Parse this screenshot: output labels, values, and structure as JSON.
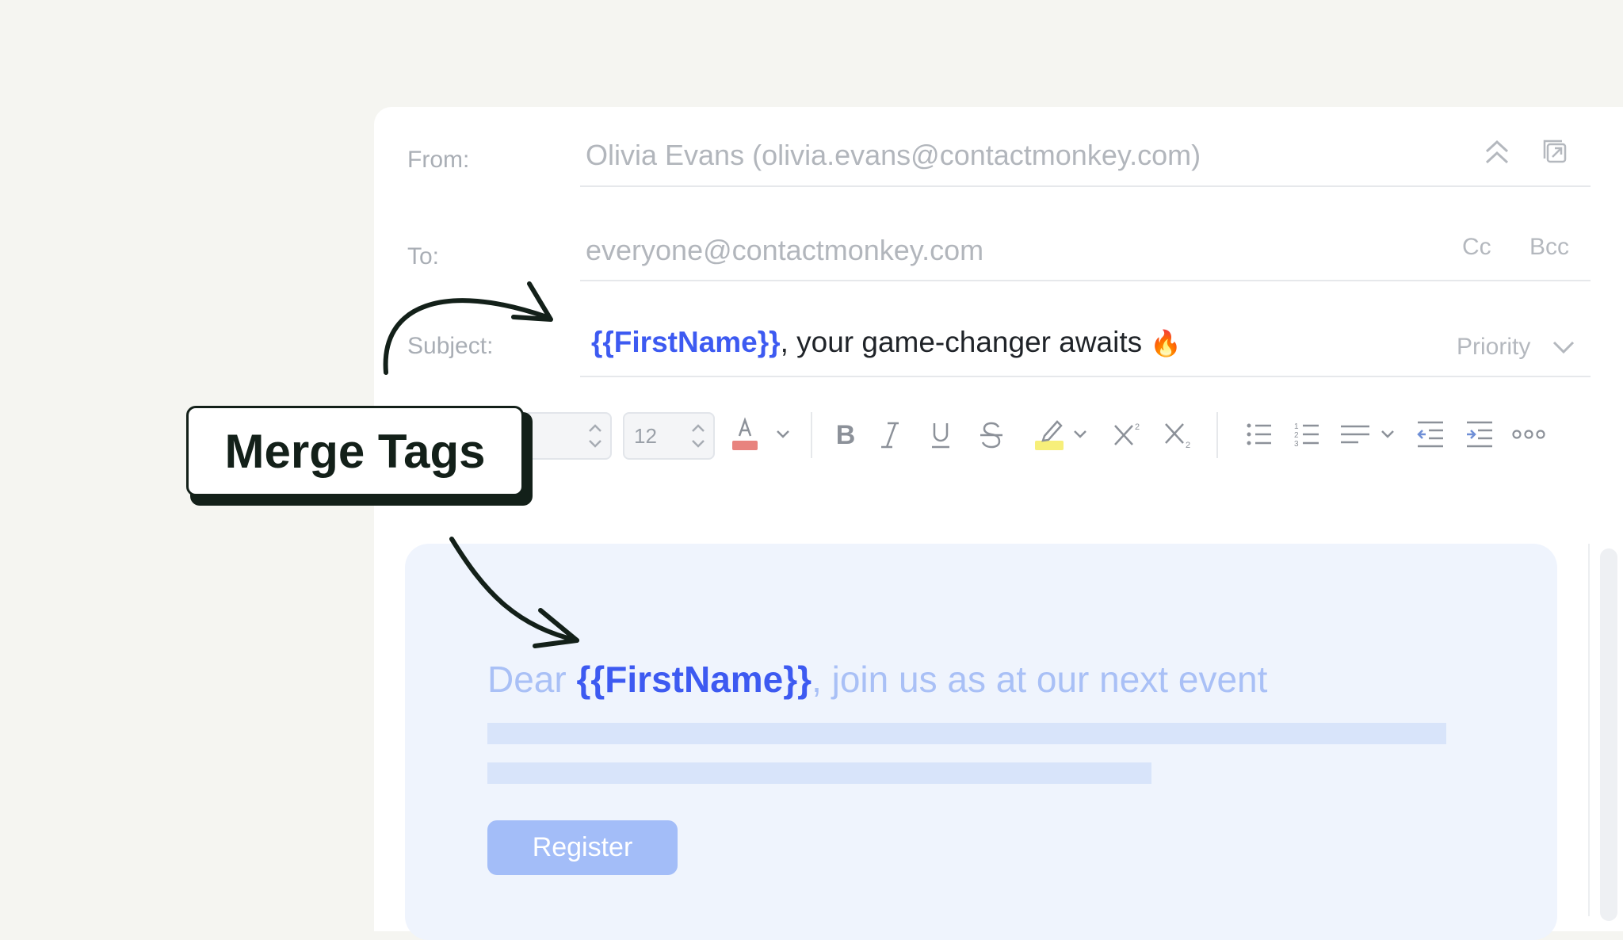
{
  "header": {
    "from_label": "From:",
    "from_value": "Olivia Evans (olivia.evans@contactmonkey.com)",
    "to_label": "To:",
    "to_value": "everyone@contactmonkey.com",
    "cc_label": "Cc",
    "bcc_label": "Bcc",
    "subject_label": "Subject:",
    "subject_tag": "{{FirstName}}",
    "subject_rest": ", your game-changer awaits",
    "subject_emoji": "🔥",
    "priority_label": "Priority"
  },
  "toolbar": {
    "font_size": "12",
    "font_color": "#e8837e",
    "highlight_color": "#f7ef7a"
  },
  "body": {
    "greeting": "Dear ",
    "tag": "{{FirstName}}",
    "rest": ", join us as at our next event",
    "button_label": "Register"
  },
  "callout": {
    "label": "Merge Tags"
  },
  "colors": {
    "accent": "#3d5af1",
    "editor_bg": "#eff4fd",
    "button_bg": "#a3bdf8",
    "callout_ink": "#132019"
  }
}
